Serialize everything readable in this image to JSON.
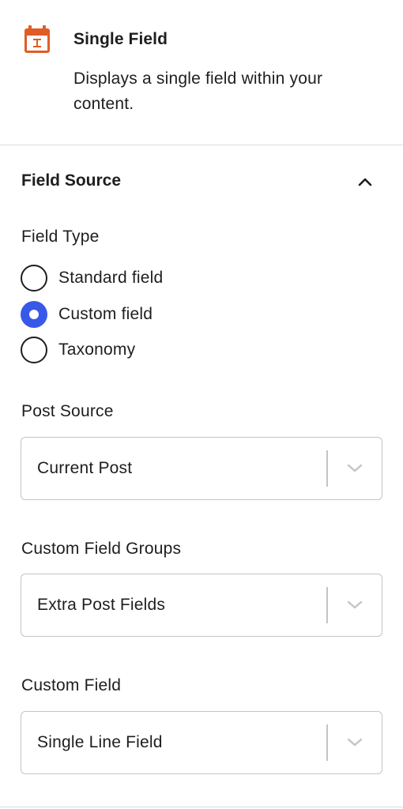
{
  "block": {
    "icon": "calendar-field-icon",
    "title": "Single Field",
    "description": "Displays a single field within your content."
  },
  "panel": {
    "title": "Field Source",
    "toggle_icon": "chevron-up-icon",
    "expanded": true
  },
  "field_type": {
    "label": "Field Type",
    "options": [
      {
        "label": "Standard field",
        "checked": false
      },
      {
        "label": "Custom field",
        "checked": true
      },
      {
        "label": "Taxonomy",
        "checked": false
      }
    ]
  },
  "post_source": {
    "label": "Post Source",
    "value": "Current Post"
  },
  "custom_field_groups": {
    "label": "Custom Field Groups",
    "value": "Extra Post Fields"
  },
  "custom_field": {
    "label": "Custom Field",
    "value": "Single Line Field"
  },
  "colors": {
    "accent": "#3858e9",
    "icon": "#e05d26",
    "text": "#1e1e1e",
    "border": "#c3c4c7"
  }
}
